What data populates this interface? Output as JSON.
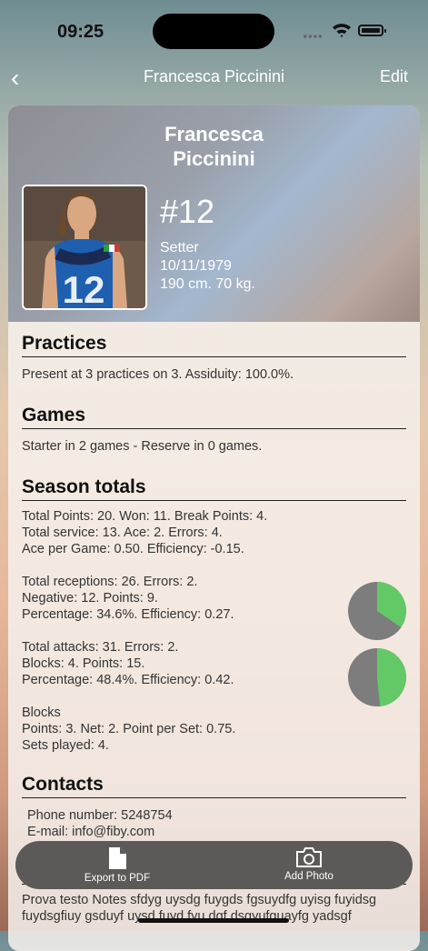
{
  "status": {
    "time": "09:25"
  },
  "nav": {
    "back": "‹",
    "title": "Francesca Piccinini",
    "edit": "Edit"
  },
  "player": {
    "name_line1": "Francesca",
    "name_line2": "Piccinini",
    "number": "#12",
    "role": "Setter",
    "birthdate": "10/11/1979",
    "measures": "190 cm. 70 kg.",
    "jersey_number": "12"
  },
  "practices": {
    "title": "Practices",
    "text": "Present at 3 practices on 3. Assiduity: 100.0%."
  },
  "games": {
    "title": "Games",
    "text": "Starter in 2 games - Reserve in 0 games."
  },
  "season": {
    "title": "Season totals",
    "points": [
      "Total Points: 20. Won: 11. Break Points: 4.",
      "Total service: 13. Ace: 2. Errors: 4.",
      "Ace per Game: 0.50. Efficiency: -0.15."
    ],
    "receptions": [
      "Total receptions: 26. Errors: 2.",
      "Negative: 12. Points: 9.",
      "Percentage: 34.6%. Efficiency: 0.27."
    ],
    "attacks": [
      "Total attacks: 31. Errors: 2.",
      "Blocks: 4. Points: 15.",
      "Percentage: 48.4%. Efficiency: 0.42."
    ],
    "blocks": [
      "Blocks",
      "Points: 3. Net: 2. Point per Set: 0.75.",
      "Sets played: 4."
    ],
    "reception_pie_fraction": 0.346,
    "attack_pie_fraction": 0.484
  },
  "contacts": {
    "title": "Contacts",
    "phone": "Phone number: 5248754",
    "email": "E-mail: info@fiby.com"
  },
  "notes": {
    "line1": "Prova testo Notes sfdyg uysdg fuygds fgsuydfg uyisg fuyidsg",
    "line2": "fuydsgfiuy gsduyf uysd fuyd fyu dgf dsgyufguayfg yadsgf"
  },
  "toolbar": {
    "export": "Export to PDF",
    "photo": "Add Photo"
  },
  "colors": {
    "pie_green": "#63c866",
    "pie_gray": "#7d7d7d"
  }
}
